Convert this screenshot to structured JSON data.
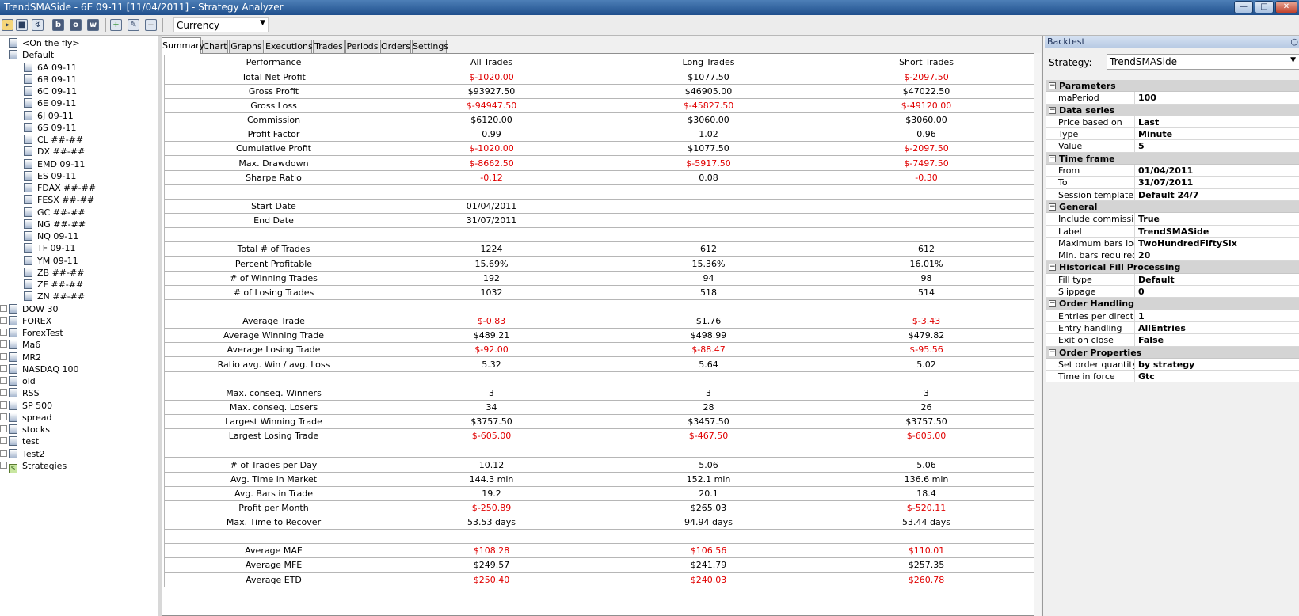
{
  "window": {
    "title": "TrendSMASide - 6E 09-11 [11/04/2011] - Strategy Analyzer"
  },
  "toolbar": {
    "currency": "Currency"
  },
  "tree": {
    "items": [
      {
        "label": "<On the fly>",
        "level": 0
      },
      {
        "label": "Default",
        "level": 0
      },
      {
        "label": "6A 09-11",
        "level": 1
      },
      {
        "label": "6B 09-11",
        "level": 1
      },
      {
        "label": "6C 09-11",
        "level": 1
      },
      {
        "label": "6E 09-11",
        "level": 1
      },
      {
        "label": "6J 09-11",
        "level": 1
      },
      {
        "label": "6S 09-11",
        "level": 1
      },
      {
        "label": "CL ##-##",
        "level": 1
      },
      {
        "label": "DX ##-##",
        "level": 1
      },
      {
        "label": "EMD 09-11",
        "level": 1
      },
      {
        "label": "ES 09-11",
        "level": 1
      },
      {
        "label": "FDAX ##-##",
        "level": 1
      },
      {
        "label": "FESX ##-##",
        "level": 1
      },
      {
        "label": "GC ##-##",
        "level": 1
      },
      {
        "label": "NG ##-##",
        "level": 1
      },
      {
        "label": "NQ 09-11",
        "level": 1
      },
      {
        "label": "TF 09-11",
        "level": 1
      },
      {
        "label": "YM 09-11",
        "level": 1
      },
      {
        "label": "ZB ##-##",
        "level": 1
      },
      {
        "label": "ZF ##-##",
        "level": 1
      },
      {
        "label": "ZN ##-##",
        "level": 1
      },
      {
        "label": "DOW 30",
        "level": 0
      },
      {
        "label": "FOREX",
        "level": 0
      },
      {
        "label": "ForexTest",
        "level": 0
      },
      {
        "label": "Ma6",
        "level": 0
      },
      {
        "label": "MR2",
        "level": 0
      },
      {
        "label": "NASDAQ 100",
        "level": 0
      },
      {
        "label": "old",
        "level": 0
      },
      {
        "label": "RSS",
        "level": 0
      },
      {
        "label": "SP 500",
        "level": 0
      },
      {
        "label": "spread",
        "level": 0
      },
      {
        "label": "stocks",
        "level": 0
      },
      {
        "label": "test",
        "level": 0
      },
      {
        "label": "Test2",
        "level": 0
      },
      {
        "label": "Strategies",
        "level": 0,
        "icon": "dollar"
      }
    ]
  },
  "tabs": [
    "Summary",
    "Chart",
    "Graphs",
    "Executions",
    "Trades",
    "Periods",
    "Orders",
    "Settings"
  ],
  "active_tab": "Summary",
  "summary": {
    "headers": [
      "Performance",
      "All Trades",
      "Long Trades",
      "Short Trades"
    ],
    "rows": [
      {
        "label": "Total Net Profit",
        "values": [
          "$-1020.00",
          "$1077.50",
          "$-2097.50"
        ]
      },
      {
        "label": "Gross Profit",
        "values": [
          "$93927.50",
          "$46905.00",
          "$47022.50"
        ]
      },
      {
        "label": "Gross Loss",
        "values": [
          "$-94947.50",
          "$-45827.50",
          "$-49120.00"
        ]
      },
      {
        "label": "Commission",
        "values": [
          "$6120.00",
          "$3060.00",
          "$3060.00"
        ]
      },
      {
        "label": "Profit Factor",
        "values": [
          "0.99",
          "1.02",
          "0.96"
        ]
      },
      {
        "label": "Cumulative Profit",
        "values": [
          "$-1020.00",
          "$1077.50",
          "$-2097.50"
        ]
      },
      {
        "label": "Max. Drawdown",
        "values": [
          "$-8662.50",
          "$-5917.50",
          "$-7497.50"
        ]
      },
      {
        "label": "Sharpe Ratio",
        "values": [
          "-0.12",
          "0.08",
          "-0.30"
        ]
      },
      {
        "label": "",
        "values": [
          "",
          "",
          ""
        ]
      },
      {
        "label": "Start Date",
        "values": [
          "01/04/2011",
          "",
          ""
        ]
      },
      {
        "label": "End Date",
        "values": [
          "31/07/2011",
          "",
          ""
        ]
      },
      {
        "label": "",
        "values": [
          "",
          "",
          ""
        ]
      },
      {
        "label": "Total # of Trades",
        "values": [
          "1224",
          "612",
          "612"
        ]
      },
      {
        "label": "Percent Profitable",
        "values": [
          "15.69%",
          "15.36%",
          "16.01%"
        ]
      },
      {
        "label": "# of Winning Trades",
        "values": [
          "192",
          "94",
          "98"
        ]
      },
      {
        "label": "# of Losing Trades",
        "values": [
          "1032",
          "518",
          "514"
        ]
      },
      {
        "label": "",
        "values": [
          "",
          "",
          ""
        ]
      },
      {
        "label": "Average Trade",
        "values": [
          "$-0.83",
          "$1.76",
          "$-3.43"
        ]
      },
      {
        "label": "Average Winning Trade",
        "values": [
          "$489.21",
          "$498.99",
          "$479.82"
        ]
      },
      {
        "label": "Average Losing Trade",
        "values": [
          "$-92.00",
          "$-88.47",
          "$-95.56"
        ]
      },
      {
        "label": "Ratio avg. Win / avg. Loss",
        "values": [
          "5.32",
          "5.64",
          "5.02"
        ]
      },
      {
        "label": "",
        "values": [
          "",
          "",
          ""
        ]
      },
      {
        "label": "Max. conseq. Winners",
        "values": [
          "3",
          "3",
          "3"
        ]
      },
      {
        "label": "Max. conseq. Losers",
        "values": [
          "34",
          "28",
          "26"
        ]
      },
      {
        "label": "Largest Winning Trade",
        "values": [
          "$3757.50",
          "$3457.50",
          "$3757.50"
        ]
      },
      {
        "label": "Largest Losing Trade",
        "values": [
          "$-605.00",
          "$-467.50",
          "$-605.00"
        ]
      },
      {
        "label": "",
        "values": [
          "",
          "",
          ""
        ]
      },
      {
        "label": "# of Trades per Day",
        "values": [
          "10.12",
          "5.06",
          "5.06"
        ]
      },
      {
        "label": "Avg. Time in Market",
        "values": [
          "144.3 min",
          "152.1 min",
          "136.6 min"
        ]
      },
      {
        "label": "Avg. Bars in Trade",
        "values": [
          "19.2",
          "20.1",
          "18.4"
        ]
      },
      {
        "label": "Profit per Month",
        "values": [
          "$-250.89",
          "$265.03",
          "$-520.11"
        ]
      },
      {
        "label": "Max. Time to Recover",
        "values": [
          "53.53 days",
          "94.94 days",
          "53.44 days"
        ]
      },
      {
        "label": "",
        "values": [
          "",
          "",
          ""
        ]
      },
      {
        "label": "Average MAE",
        "values": [
          "$108.28",
          "$106.56",
          "$110.01"
        ]
      },
      {
        "label": "Average MFE",
        "values": [
          "$249.57",
          "$241.79",
          "$257.35"
        ]
      },
      {
        "label": "Average ETD",
        "values": [
          "$250.40",
          "$240.03",
          "$260.78"
        ]
      }
    ],
    "red_rows": [
      "Total Net Profit",
      "Gross Loss",
      "Cumulative Profit",
      "Max. Drawdown",
      "Sharpe Ratio",
      "Average Trade",
      "Average Losing Trade",
      "Largest Losing Trade",
      "Profit per Month",
      "Average MAE",
      "Average ETD"
    ]
  },
  "backtest": {
    "header": "Backtest",
    "strategy_label": "Strategy:",
    "strategy_value": "TrendSMASide",
    "categories": [
      {
        "name": "Parameters",
        "props": [
          {
            "label": "maPeriod",
            "value": "100"
          }
        ]
      },
      {
        "name": "Data series",
        "props": [
          {
            "label": "Price based on",
            "value": "Last"
          },
          {
            "label": "Type",
            "value": "Minute"
          },
          {
            "label": "Value",
            "value": "5"
          }
        ]
      },
      {
        "name": "Time frame",
        "props": [
          {
            "label": "From",
            "value": "01/04/2011"
          },
          {
            "label": "To",
            "value": "31/07/2011"
          },
          {
            "label": "Session template",
            "value": "Default 24/7"
          }
        ]
      },
      {
        "name": "General",
        "props": [
          {
            "label": "Include commission",
            "value": "True"
          },
          {
            "label": "Label",
            "value": "TrendSMASide"
          },
          {
            "label": "Maximum bars look bac",
            "value": "TwoHundredFiftySix"
          },
          {
            "label": "Min. bars required",
            "value": "20"
          }
        ]
      },
      {
        "name": "Historical Fill Processing",
        "props": [
          {
            "label": "Fill type",
            "value": "Default"
          },
          {
            "label": "Slippage",
            "value": "0"
          }
        ]
      },
      {
        "name": "Order Handling",
        "props": [
          {
            "label": "Entries per direction",
            "value": "1"
          },
          {
            "label": "Entry handling",
            "value": "AllEntries"
          },
          {
            "label": "Exit on close",
            "value": "False"
          }
        ]
      },
      {
        "name": "Order Properties",
        "props": [
          {
            "label": "Set order quantity",
            "value": "by strategy"
          },
          {
            "label": "Time in force",
            "value": "Gtc"
          }
        ]
      }
    ]
  },
  "colors": {
    "negative": "#e00000",
    "titlebar": "#1f4f8c"
  }
}
